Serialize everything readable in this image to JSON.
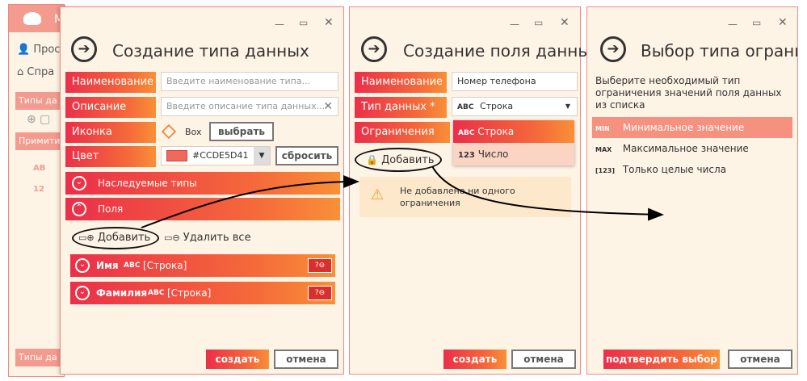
{
  "colors": {
    "accent_red": "#eb2f4a",
    "accent_orange": "#f99038",
    "bg": "#fef4e6",
    "frame": "#f08a80",
    "swatch": "#CDE5D4"
  },
  "back": {
    "logo": "M",
    "menu": [
      "Прос",
      "Спра"
    ],
    "tab1": "Типы да",
    "tab2": "Примити",
    "tab3": "Типы да"
  },
  "w1": {
    "title": "Создание типа данных",
    "fields": {
      "name_label": "Наименование *",
      "name_placeholder": "Введите наименование типа...",
      "desc_label": "Описание",
      "desc_placeholder": "Введите описание типа данных...",
      "icon_label": "Иконка",
      "icon_value": "Box",
      "choose": "выбрать",
      "color_label": "Цвет",
      "color_value": "#CCDE5D41",
      "reset": "сбросить"
    },
    "inherited": "Наследуемые типы",
    "fields_section": "Поля",
    "add": "Добавить",
    "remove_all": "Удалить все",
    "rows": [
      {
        "name": "Имя",
        "type_icon": "ABC",
        "type": "[Строка]"
      },
      {
        "name": "Фамилия",
        "type_icon": "ABC",
        "type": "[Строка]"
      }
    ],
    "create": "создать",
    "cancel": "отмена"
  },
  "w2": {
    "title": "Создание поля данных",
    "name_label": "Наименование *",
    "name_value": "Номер телефона",
    "type_label": "Тип данных *",
    "type_icon": "ABC",
    "type_value": "Строка",
    "constraints_label": "Ограничения",
    "add": "Добавить",
    "dropdown": [
      {
        "icon": "ABC",
        "label": "Строка"
      },
      {
        "icon": "123",
        "label": "Число"
      }
    ],
    "warning": "Не добавлено ни одного ограничения",
    "create": "создать",
    "cancel": "отмена"
  },
  "w3": {
    "title": "Выбор типа огранич",
    "prompt": "Выберите необходимый тип ограничения значений поля данных из списка",
    "items": [
      {
        "icon": "MIN",
        "label": "Минимальное значение"
      },
      {
        "icon": "MAX",
        "label": "Максимальное значение"
      },
      {
        "icon": "[123]",
        "label": "Только целые числа"
      }
    ],
    "confirm": "подтвердить выбор",
    "cancel": "отмена"
  }
}
